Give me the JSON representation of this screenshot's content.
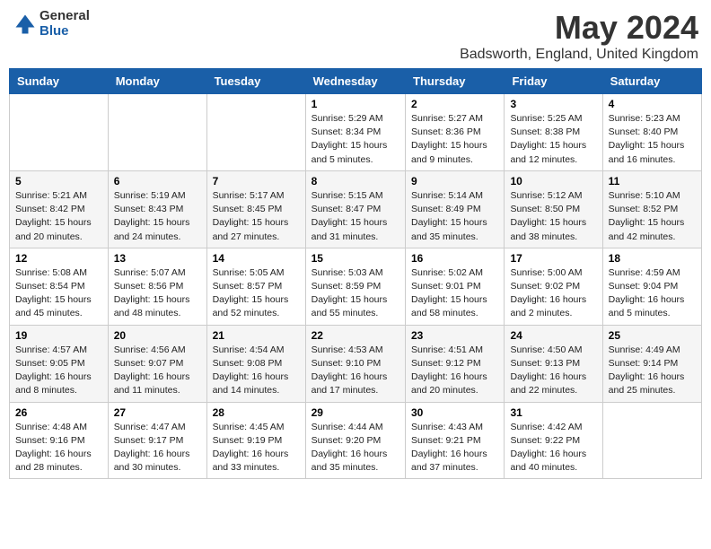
{
  "header": {
    "logo_general": "General",
    "logo_blue": "Blue",
    "title": "May 2024",
    "location": "Badsworth, England, United Kingdom"
  },
  "weekdays": [
    "Sunday",
    "Monday",
    "Tuesday",
    "Wednesday",
    "Thursday",
    "Friday",
    "Saturday"
  ],
  "rows": [
    [
      {
        "day": "",
        "info": ""
      },
      {
        "day": "",
        "info": ""
      },
      {
        "day": "",
        "info": ""
      },
      {
        "day": "1",
        "info": "Sunrise: 5:29 AM\nSunset: 8:34 PM\nDaylight: 15 hours\nand 5 minutes."
      },
      {
        "day": "2",
        "info": "Sunrise: 5:27 AM\nSunset: 8:36 PM\nDaylight: 15 hours\nand 9 minutes."
      },
      {
        "day": "3",
        "info": "Sunrise: 5:25 AM\nSunset: 8:38 PM\nDaylight: 15 hours\nand 12 minutes."
      },
      {
        "day": "4",
        "info": "Sunrise: 5:23 AM\nSunset: 8:40 PM\nDaylight: 15 hours\nand 16 minutes."
      }
    ],
    [
      {
        "day": "5",
        "info": "Sunrise: 5:21 AM\nSunset: 8:42 PM\nDaylight: 15 hours\nand 20 minutes."
      },
      {
        "day": "6",
        "info": "Sunrise: 5:19 AM\nSunset: 8:43 PM\nDaylight: 15 hours\nand 24 minutes."
      },
      {
        "day": "7",
        "info": "Sunrise: 5:17 AM\nSunset: 8:45 PM\nDaylight: 15 hours\nand 27 minutes."
      },
      {
        "day": "8",
        "info": "Sunrise: 5:15 AM\nSunset: 8:47 PM\nDaylight: 15 hours\nand 31 minutes."
      },
      {
        "day": "9",
        "info": "Sunrise: 5:14 AM\nSunset: 8:49 PM\nDaylight: 15 hours\nand 35 minutes."
      },
      {
        "day": "10",
        "info": "Sunrise: 5:12 AM\nSunset: 8:50 PM\nDaylight: 15 hours\nand 38 minutes."
      },
      {
        "day": "11",
        "info": "Sunrise: 5:10 AM\nSunset: 8:52 PM\nDaylight: 15 hours\nand 42 minutes."
      }
    ],
    [
      {
        "day": "12",
        "info": "Sunrise: 5:08 AM\nSunset: 8:54 PM\nDaylight: 15 hours\nand 45 minutes."
      },
      {
        "day": "13",
        "info": "Sunrise: 5:07 AM\nSunset: 8:56 PM\nDaylight: 15 hours\nand 48 minutes."
      },
      {
        "day": "14",
        "info": "Sunrise: 5:05 AM\nSunset: 8:57 PM\nDaylight: 15 hours\nand 52 minutes."
      },
      {
        "day": "15",
        "info": "Sunrise: 5:03 AM\nSunset: 8:59 PM\nDaylight: 15 hours\nand 55 minutes."
      },
      {
        "day": "16",
        "info": "Sunrise: 5:02 AM\nSunset: 9:01 PM\nDaylight: 15 hours\nand 58 minutes."
      },
      {
        "day": "17",
        "info": "Sunrise: 5:00 AM\nSunset: 9:02 PM\nDaylight: 16 hours\nand 2 minutes."
      },
      {
        "day": "18",
        "info": "Sunrise: 4:59 AM\nSunset: 9:04 PM\nDaylight: 16 hours\nand 5 minutes."
      }
    ],
    [
      {
        "day": "19",
        "info": "Sunrise: 4:57 AM\nSunset: 9:05 PM\nDaylight: 16 hours\nand 8 minutes."
      },
      {
        "day": "20",
        "info": "Sunrise: 4:56 AM\nSunset: 9:07 PM\nDaylight: 16 hours\nand 11 minutes."
      },
      {
        "day": "21",
        "info": "Sunrise: 4:54 AM\nSunset: 9:08 PM\nDaylight: 16 hours\nand 14 minutes."
      },
      {
        "day": "22",
        "info": "Sunrise: 4:53 AM\nSunset: 9:10 PM\nDaylight: 16 hours\nand 17 minutes."
      },
      {
        "day": "23",
        "info": "Sunrise: 4:51 AM\nSunset: 9:12 PM\nDaylight: 16 hours\nand 20 minutes."
      },
      {
        "day": "24",
        "info": "Sunrise: 4:50 AM\nSunset: 9:13 PM\nDaylight: 16 hours\nand 22 minutes."
      },
      {
        "day": "25",
        "info": "Sunrise: 4:49 AM\nSunset: 9:14 PM\nDaylight: 16 hours\nand 25 minutes."
      }
    ],
    [
      {
        "day": "26",
        "info": "Sunrise: 4:48 AM\nSunset: 9:16 PM\nDaylight: 16 hours\nand 28 minutes."
      },
      {
        "day": "27",
        "info": "Sunrise: 4:47 AM\nSunset: 9:17 PM\nDaylight: 16 hours\nand 30 minutes."
      },
      {
        "day": "28",
        "info": "Sunrise: 4:45 AM\nSunset: 9:19 PM\nDaylight: 16 hours\nand 33 minutes."
      },
      {
        "day": "29",
        "info": "Sunrise: 4:44 AM\nSunset: 9:20 PM\nDaylight: 16 hours\nand 35 minutes."
      },
      {
        "day": "30",
        "info": "Sunrise: 4:43 AM\nSunset: 9:21 PM\nDaylight: 16 hours\nand 37 minutes."
      },
      {
        "day": "31",
        "info": "Sunrise: 4:42 AM\nSunset: 9:22 PM\nDaylight: 16 hours\nand 40 minutes."
      },
      {
        "day": "",
        "info": ""
      }
    ]
  ]
}
